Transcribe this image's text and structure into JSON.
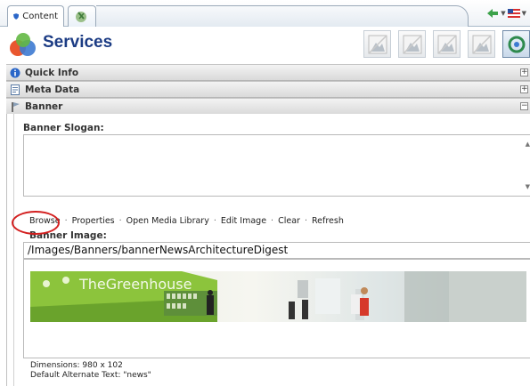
{
  "tabs": [
    {
      "label": "Content",
      "icon": "shield-icon",
      "active": true
    },
    {
      "label": "",
      "icon": "globe-icon",
      "active": false
    }
  ],
  "title": {
    "text": "Services",
    "icon": "services-logo-icon"
  },
  "toolbar": {
    "buttons": [
      "image-placeholder-icon",
      "image-placeholder-icon",
      "image-placeholder-icon",
      "image-placeholder-icon",
      "cycle-icon"
    ]
  },
  "sections": [
    {
      "label": "Quick Info",
      "icon": "info-icon",
      "toggle": "+"
    },
    {
      "label": "Meta Data",
      "icon": "document-icon",
      "toggle": "+"
    },
    {
      "label": "Banner",
      "icon": "banner-icon",
      "toggle": "−"
    }
  ],
  "banner": {
    "slogan_label": "Banner Slogan:",
    "slogan_value": "",
    "links": [
      "Browse",
      "Properties",
      "Open Media Library",
      "Edit Image",
      "Clear",
      "Refresh"
    ],
    "image_label": "Banner Image:",
    "image_path": "/Images/Banners/bannerNewsArchitectureDigest",
    "image_text": "TheGreenhouse",
    "dimensions": "Dimensions: 980 x 102",
    "alt_text": "Default Alternate Text: \"news\""
  },
  "colors": {
    "title": "#1c3c84",
    "highlight_circle": "#d31f1f",
    "section_header": "#dadada"
  }
}
